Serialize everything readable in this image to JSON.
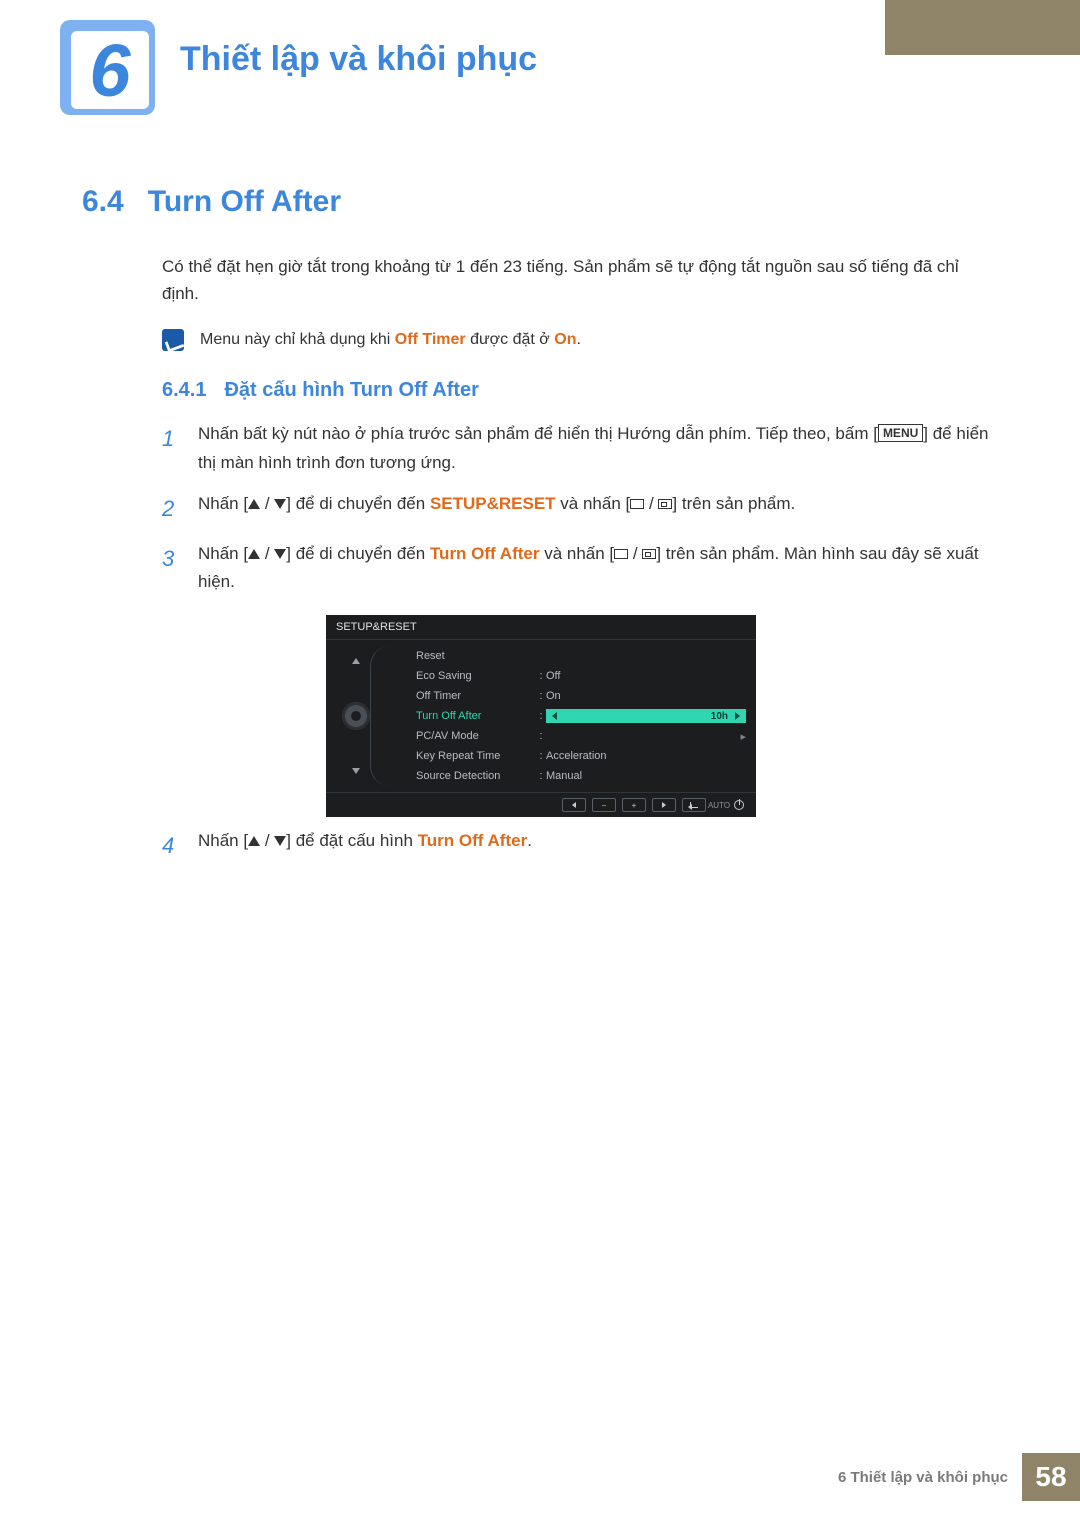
{
  "chapter": {
    "num": "6",
    "title": "Thiết lập và khôi phục"
  },
  "section": {
    "num": "6.4",
    "title": "Turn Off After"
  },
  "intro": "Có thể đặt hẹn giờ tắt trong khoảng từ 1 đến 23 tiếng. Sản phẩm sẽ tự động tắt nguồn sau số tiếng đã chỉ định.",
  "note": {
    "pre": "Menu này chỉ khả dụng khi ",
    "mid": "Off Timer",
    "mid2": " được đặt ở ",
    "end": "On",
    "tail": "."
  },
  "subsection": {
    "num": "6.4.1",
    "title": "Đặt cấu hình Turn Off After"
  },
  "steps": {
    "1": {
      "a": "Nhấn bất kỳ nút nào ở phía trước sản phẩm để hiển thị Hướng dẫn phím. Tiếp theo, bấm [",
      "menu": "MENU",
      "b": "] để hiển thị màn hình trình đơn tương ứng."
    },
    "2": {
      "a": "Nhấn [",
      "b": "] để di chuyển đến ",
      "target": "SETUP&RESET",
      "c": " và nhấn [",
      "d": "] trên sản phẩm."
    },
    "3": {
      "a": "Nhấn [",
      "b": "] để di chuyển đến ",
      "target": "Turn Off After",
      "c": " và nhấn [",
      "d": "] trên sản phẩm. Màn hình sau đây sẽ xuất hiện."
    },
    "4": {
      "a": "Nhấn [",
      "b": "] để đặt cấu hình ",
      "target": "Turn Off After",
      "c": "."
    }
  },
  "osd": {
    "title": "SETUP&RESET",
    "rows": [
      {
        "label": "Reset",
        "value": ""
      },
      {
        "label": "Eco Saving",
        "value": "Off"
      },
      {
        "label": "Off Timer",
        "value": "On"
      },
      {
        "label": "Turn Off After",
        "value": "10h",
        "selected": true
      },
      {
        "label": "PC/AV Mode",
        "value": ""
      },
      {
        "label": "Key Repeat Time",
        "value": "Acceleration"
      },
      {
        "label": "Source Detection",
        "value": "Manual"
      }
    ],
    "footer": {
      "minus": "−",
      "plus": "+",
      "auto": "AUTO"
    }
  },
  "footer": {
    "text": "6 Thiết lập và khôi phục",
    "page": "58"
  }
}
